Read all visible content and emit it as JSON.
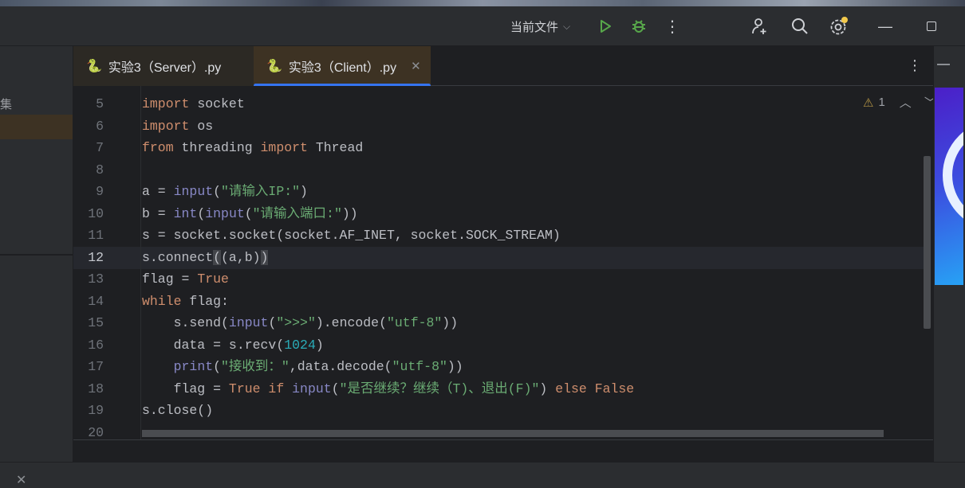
{
  "titlebar": {
    "run_config": "当前文件",
    "icons": [
      "chevron-down-icon",
      "run-icon",
      "debug-icon",
      "more-icon",
      "add-user-icon",
      "search-icon",
      "settings-icon",
      "minimize-icon",
      "maximize-icon"
    ],
    "colors": {
      "run": "#57a64a",
      "notification": "#f2c94c"
    }
  },
  "left_panel": {
    "label": "集"
  },
  "tabs": [
    {
      "label": "实验3（Server）.py"
    },
    {
      "label": "实验3（Client）.py",
      "active": true
    }
  ],
  "editor": {
    "inspection_count": "1",
    "current_line": 12,
    "lines": [
      {
        "n": "5",
        "tokens": [
          [
            "kw",
            "import"
          ],
          [
            "",
            "socket"
          ]
        ]
      },
      {
        "n": "6",
        "tokens": [
          [
            "kw",
            "import"
          ],
          [
            "",
            "os"
          ]
        ]
      },
      {
        "n": "7",
        "tokens": [
          [
            "kw",
            "from"
          ],
          [
            "",
            " threading "
          ],
          [
            "kw",
            "import"
          ],
          [
            "",
            " Thread"
          ]
        ]
      },
      {
        "n": "8",
        "tokens": []
      },
      {
        "n": "9",
        "tokens": [
          [
            "",
            "a = "
          ],
          [
            "bi",
            "input"
          ],
          [
            "",
            "("
          ],
          [
            "st",
            "\"请输入IP:\""
          ],
          [
            "",
            ")"
          ]
        ]
      },
      {
        "n": "10",
        "tokens": [
          [
            "",
            "b = "
          ],
          [
            "bi",
            "int"
          ],
          [
            "",
            "("
          ],
          [
            "bi",
            "input"
          ],
          [
            "",
            "("
          ],
          [
            "st",
            "\"请输入端口:\""
          ],
          [
            "",
            "))"
          ]
        ]
      },
      {
        "n": "11",
        "tokens": [
          [
            "",
            "s = socket.socket(socket.AF_INET, socket.SOCK_STREAM)"
          ]
        ]
      },
      {
        "n": "12",
        "tokens": [
          [
            "",
            "s.connect"
          ],
          [
            "br",
            "("
          ],
          [
            "",
            "(a,b)"
          ],
          [
            "br",
            ")"
          ]
        ]
      },
      {
        "n": "13",
        "tokens": [
          [
            "",
            "flag = "
          ],
          [
            "kw",
            "True"
          ]
        ]
      },
      {
        "n": "14",
        "tokens": [
          [
            "kw",
            "while"
          ],
          [
            "",
            " flag:"
          ]
        ]
      },
      {
        "n": "15",
        "tokens": [
          [
            "",
            "    s.send("
          ],
          [
            "bi",
            "input"
          ],
          [
            "",
            "("
          ],
          [
            "st",
            "\">>>\""
          ],
          [
            "",
            ").encode("
          ],
          [
            "st",
            "\"utf-8\""
          ],
          [
            "",
            "))"
          ]
        ]
      },
      {
        "n": "16",
        "tokens": [
          [
            "",
            "    data = s.recv("
          ],
          [
            "nu",
            "1024"
          ],
          [
            "",
            ")"
          ]
        ]
      },
      {
        "n": "17",
        "tokens": [
          [
            "",
            "    "
          ],
          [
            "bi",
            "print"
          ],
          [
            "",
            "("
          ],
          [
            "st",
            "\"接收到：\""
          ],
          [
            "",
            ",data.decode("
          ],
          [
            "st",
            "\"utf-8\""
          ],
          [
            "",
            "))"
          ]
        ]
      },
      {
        "n": "18",
        "tokens": [
          [
            "",
            "    flag = "
          ],
          [
            "kw",
            "True if "
          ],
          [
            "bi",
            "input"
          ],
          [
            "",
            "("
          ],
          [
            "st",
            "\"是否继续？继续（T)、退出(F)\""
          ],
          [
            "",
            ") "
          ],
          [
            "kw",
            "else False"
          ]
        ]
      },
      {
        "n": "19",
        "tokens": [
          [
            "",
            "s.close()"
          ]
        ]
      },
      {
        "n": "20",
        "tokens": []
      }
    ]
  }
}
